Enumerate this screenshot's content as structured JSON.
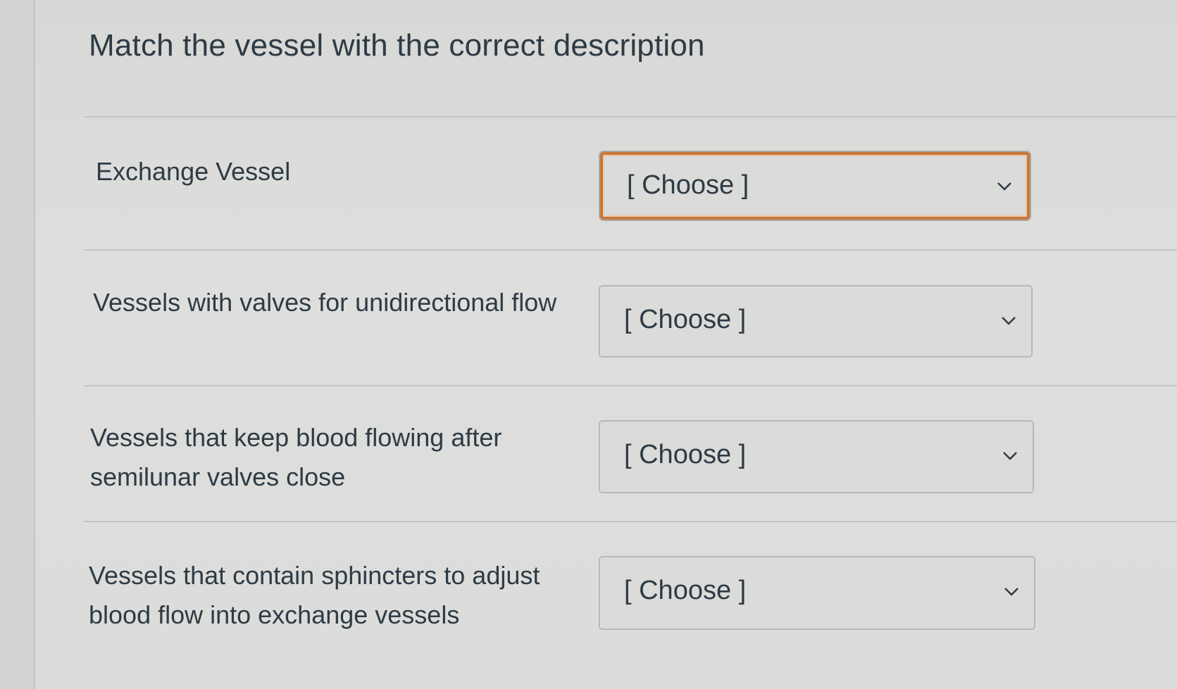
{
  "question": {
    "title": "Match the vessel with the correct description"
  },
  "rows": [
    {
      "label": "Exchange Vessel",
      "selected": "[ Choose ]",
      "focused": true
    },
    {
      "label": "Vessels with valves for unidirectional flow",
      "selected": "[ Choose ]",
      "focused": false
    },
    {
      "label": "Vessels that keep blood flowing after semilunar valves close",
      "selected": "[ Choose ]",
      "focused": false
    },
    {
      "label": "Vessels that contain sphincters to adjust blood flow into exchange vessels",
      "selected": "[ Choose ]",
      "focused": false
    }
  ],
  "icons": {
    "dropdown": "chevron-down-icon"
  },
  "colors": {
    "focus_outline": "#c9773a",
    "text": "#2d3b45"
  }
}
